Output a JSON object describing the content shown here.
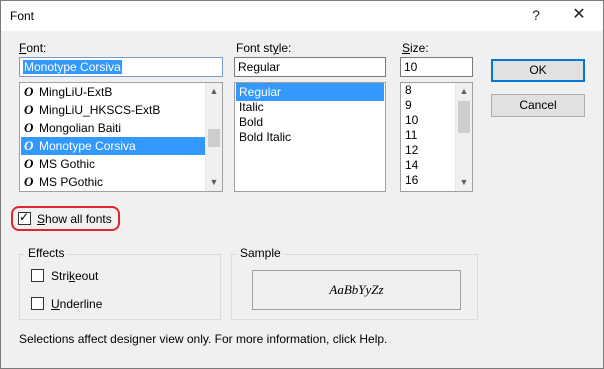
{
  "window": {
    "title": "Font",
    "help_glyph": "?",
    "close_glyph": "✕"
  },
  "font": {
    "label": "Font:",
    "value": "Monotype Corsiva",
    "items": [
      {
        "label": "MingLiU-ExtB",
        "icon": "opentype-icon"
      },
      {
        "label": "MingLiU_HKSCS-ExtB",
        "icon": "opentype-icon"
      },
      {
        "label": "Mongolian Baiti",
        "icon": "opentype-icon"
      },
      {
        "label": "Monotype Corsiva",
        "icon": "opentype-icon",
        "selected": true
      },
      {
        "label": "MS Gothic",
        "icon": "opentype-icon"
      },
      {
        "label": "MS PGothic",
        "icon": "opentype-icon"
      }
    ]
  },
  "style": {
    "label": "Font style:",
    "value": "Regular",
    "items": [
      {
        "label": "Regular",
        "selected": true
      },
      {
        "label": "Italic"
      },
      {
        "label": "Bold"
      },
      {
        "label": "Bold Italic"
      }
    ]
  },
  "size": {
    "label": "Size:",
    "value": "10",
    "items": [
      "8",
      "9",
      "10",
      "11",
      "12",
      "14",
      "16"
    ]
  },
  "buttons": {
    "ok": "OK",
    "cancel": "Cancel"
  },
  "show_all_fonts": {
    "label": "Show all fonts",
    "checked": true
  },
  "effects": {
    "label": "Effects",
    "strikeout": "Strikeout",
    "underline": "Underline"
  },
  "sample": {
    "label": "Sample",
    "text": "AaBbYyZz"
  },
  "footer": "Selections affect designer view only. For more information, click Help.",
  "colors": {
    "selection": "#3399ff",
    "highlight_ring": "#e0242d",
    "default_button_border": "#0078d7"
  }
}
